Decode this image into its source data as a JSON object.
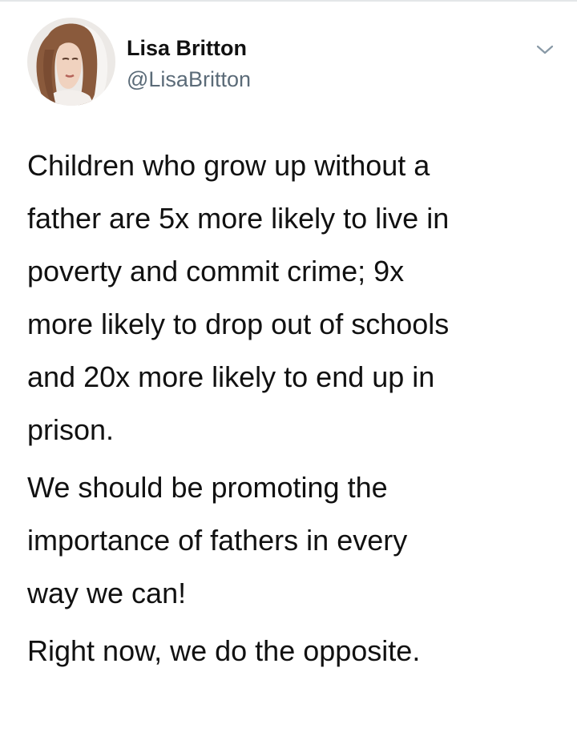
{
  "tweet": {
    "author": {
      "display_name": "Lisa Britton",
      "handle": "@LisaBritton",
      "avatar_icon": "profile-photo"
    },
    "menu_icon": "chevron-down-icon",
    "paragraphs": [
      {
        "lines": [
          "Children who grow up without a",
          "father are 5x more likely to live in",
          "poverty and commit crime; 9x",
          "more likely to drop out of schools",
          "and 20x more likely to end up in",
          "prison."
        ]
      },
      {
        "lines": [
          "We should be promoting the",
          "importance of fathers in every",
          "way we can!"
        ]
      },
      {
        "lines": [
          "Right now, we do the opposite."
        ]
      }
    ]
  },
  "colors": {
    "text": "#111111",
    "handle": "#5b6b78",
    "background": "#ffffff",
    "divider": "#e3e6e8"
  }
}
